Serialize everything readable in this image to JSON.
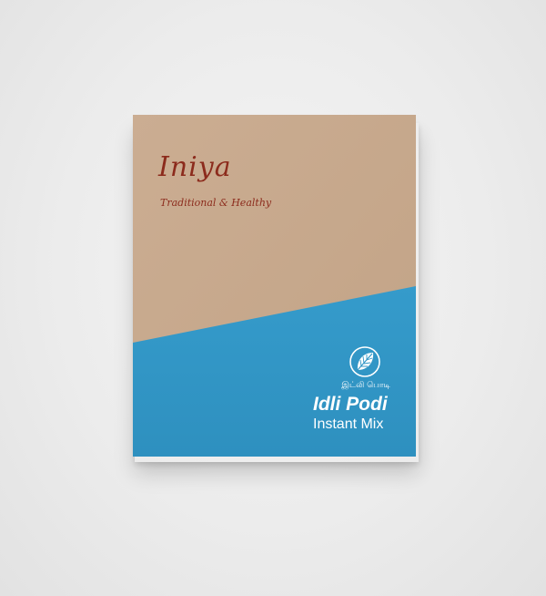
{
  "package": {
    "brand": "Iniya",
    "tagline": "Traditional & Healthy",
    "tamil_name": "இட்லி பொடி",
    "product_name": "Idli Podi",
    "product_subtitle": "Instant Mix",
    "logo_icon": "leaf-in-circle-icon",
    "colors": {
      "kraft": "#c7a88c",
      "blue": "#3196c6",
      "brand_text": "#8c2b1c",
      "label_text": "#ffffff",
      "background": "#ececec"
    }
  }
}
